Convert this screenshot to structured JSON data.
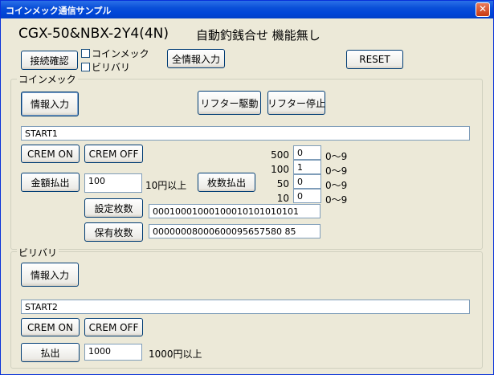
{
  "window": {
    "title": "コインメック通信サンプル",
    "close_glyph": "✕"
  },
  "header": {
    "model": "CGX-50&NBX-2Y4(4N)",
    "note": "自動釣銭合せ 機能無し"
  },
  "top": {
    "connect_label": "接続確認",
    "chk_coinmec": "コインメック",
    "chk_biribari": "ビリバリ",
    "all_info_label": "全情報入力",
    "reset_label": "RESET"
  },
  "coinmec": {
    "title": "コインメック",
    "info_label": "情報入力",
    "lifter_drive_label": "リフター駆動",
    "lifter_stop_label": "リフター停止",
    "status": "START1",
    "crem_on_label": "CREM ON",
    "crem_off_label": "CREM OFF",
    "payout_label": "金額払出",
    "amount": "100",
    "amount_note": "10円以上",
    "count_payout_label": "枚数払出",
    "denoms": [
      {
        "label": "500",
        "value": "0",
        "range": "0〜9"
      },
      {
        "label": "100",
        "value": "1",
        "range": "0〜9"
      },
      {
        "label": "50",
        "value": "0",
        "range": "0〜9"
      },
      {
        "label": "10",
        "value": "0",
        "range": "0〜9"
      }
    ],
    "setting_count_label": "設定枚数",
    "setting_count_value": "00010001000100010101010101",
    "holding_count_label": "保有枚数",
    "holding_count_value": "00000008000600095657580 85"
  },
  "biribari": {
    "title": "ビリバリ",
    "info_label": "情報入力",
    "status": "START2",
    "crem_on_label": "CREM ON",
    "crem_off_label": "CREM OFF",
    "payout_label": "払出",
    "amount": "1000",
    "amount_note": "1000円以上"
  }
}
